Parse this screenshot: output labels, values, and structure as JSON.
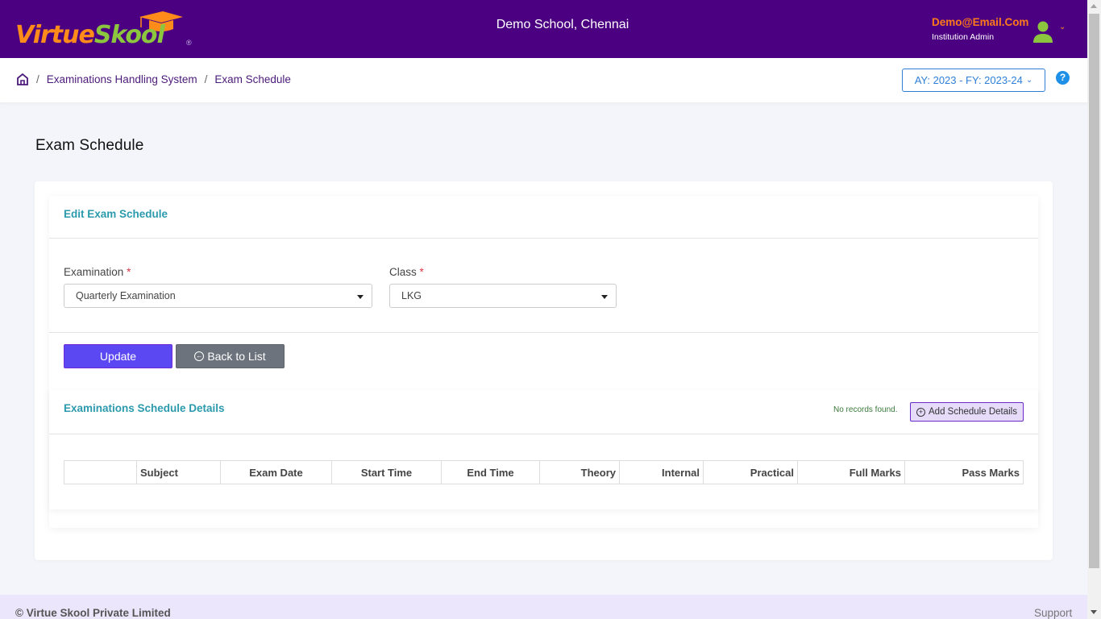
{
  "header": {
    "logo_part1": "Virtue",
    "logo_part2": "Skool",
    "logo_reg": "®",
    "school_name": "Demo School, Chennai",
    "user_email": "Demo@Email.Com",
    "user_role": "Institution Admin",
    "colors": {
      "bar": "#4b0082",
      "logo_orange": "#ff8c1a",
      "logo_green": "#8cc63f"
    }
  },
  "breadcrumb": {
    "items": [
      "Examinations Handling System",
      "Exam Schedule"
    ],
    "separator": "/",
    "home_icon": "home-icon"
  },
  "year_selector": {
    "value": "AY: 2023 - FY: 2023-24"
  },
  "help": {
    "label": "?"
  },
  "page": {
    "title": "Exam Schedule"
  },
  "form": {
    "card_title": "Edit Exam Schedule",
    "examination": {
      "label": "Examination",
      "required": "*",
      "value": "Quarterly Examination"
    },
    "class": {
      "label": "Class",
      "required": "*",
      "value": "LKG"
    },
    "update_label": "Update",
    "back_label": "Back to List"
  },
  "schedule": {
    "title": "Examinations Schedule Details",
    "status": "No records found.",
    "add_label": "Add Schedule Details",
    "columns": [
      "",
      "Subject",
      "Exam Date",
      "Start Time",
      "End Time",
      "Theory",
      "Internal",
      "Practical",
      "Full Marks",
      "Pass Marks"
    ],
    "rows": []
  },
  "footer": {
    "copyright": "© Virtue Skool Private Limited",
    "support": "Support"
  }
}
